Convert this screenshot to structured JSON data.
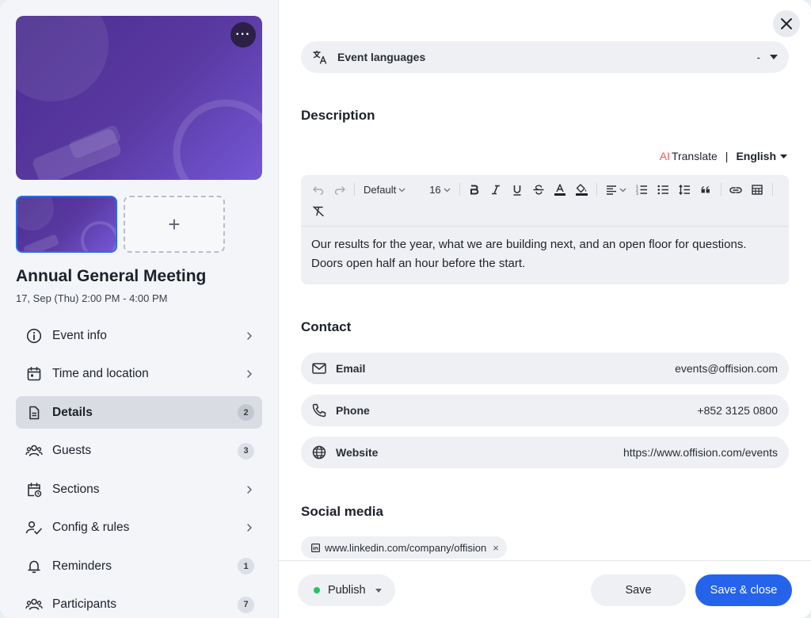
{
  "event": {
    "title": "Annual General Meeting",
    "time": "17, Sep (Thu) 2:00 PM - 4:00 PM",
    "cover_menu": "···",
    "add_image": "+"
  },
  "nav": {
    "items": [
      {
        "label": "Event info",
        "icon": "info-icon",
        "badge": null
      },
      {
        "label": "Time and location",
        "icon": "calendar-icon",
        "badge": null
      },
      {
        "label": "Details",
        "icon": "document-icon",
        "badge": "2",
        "active": true
      },
      {
        "label": "Guests",
        "icon": "people-icon",
        "badge": "3"
      },
      {
        "label": "Sections",
        "icon": "calendar-clock-icon",
        "badge": null
      },
      {
        "label": "Config & rules",
        "icon": "user-check-icon",
        "badge": null
      },
      {
        "label": "Reminders",
        "icon": "bell-icon",
        "badge": "1"
      },
      {
        "label": "Participants",
        "icon": "people-icon",
        "badge": "7"
      }
    ]
  },
  "languages": {
    "label": "Event languages",
    "value": "-"
  },
  "description": {
    "title": "Description",
    "ai": "AI",
    "translate": "Translate",
    "separator": "|",
    "language": "English",
    "toolbar": {
      "style": "Default",
      "size": "16"
    },
    "body": "Our results for the year, what we are building next, and an open floor for questions. Doors open half an hour before the start."
  },
  "contact": {
    "title": "Contact",
    "email": {
      "label": "Email",
      "value": "events@offision.com"
    },
    "phone": {
      "label": "Phone",
      "value": "+852 3125 0800"
    },
    "website": {
      "label": "Website",
      "value": "https://www.offision.com/events"
    }
  },
  "social": {
    "title": "Social media",
    "tag": "www.linkedin.com/company/offision",
    "remove": "×"
  },
  "footer": {
    "publish": "Publish",
    "save": "Save",
    "save_close": "Save & close"
  },
  "colors": {
    "accent": "#2563eb",
    "publish_dot": "#22c55e",
    "ai": "#ee5a5a",
    "cover": "#5a3aa3"
  }
}
